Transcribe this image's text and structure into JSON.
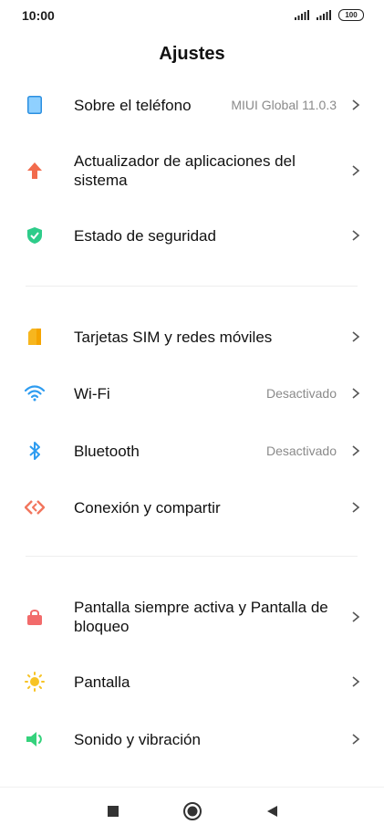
{
  "status_bar": {
    "time": "10:00",
    "battery": "100",
    "icons": [
      "signal-icon",
      "signal-icon",
      "battery-icon"
    ]
  },
  "header": {
    "title": "Ajustes"
  },
  "settings": [
    {
      "label": "Sobre el teléfono",
      "value": "MIUI Global 11.0.3",
      "icon": "phone-icon",
      "color": "#3b9ef0"
    },
    {
      "label": "Actualizador de aplicaciones del sistema",
      "value": "",
      "icon": "arrow-up-icon",
      "color": "#f26b4d"
    },
    {
      "label": "Estado de seguridad",
      "value": "",
      "icon": "shield-check-icon",
      "color": "#2ecc8a"
    },
    {
      "label": "Tarjetas SIM y redes móviles",
      "value": "",
      "icon": "sim-card-icon",
      "color": "#f7b61e"
    },
    {
      "label": "Wi-Fi",
      "value": "Desactivado",
      "icon": "wifi-icon",
      "color": "#2e9cf0"
    },
    {
      "label": "Bluetooth",
      "value": "Desactivado",
      "icon": "bluetooth-icon",
      "color": "#2e9cf0"
    },
    {
      "label": "Conexión y compartir",
      "value": "",
      "icon": "share-connection-icon",
      "color": "#f2765e"
    },
    {
      "label": "Pantalla siempre activa y Pantalla de bloqueo",
      "value": "",
      "icon": "lock-icon",
      "color": "#f26b6b"
    },
    {
      "label": "Pantalla",
      "value": "",
      "icon": "sun-icon",
      "color": "#f7c325"
    },
    {
      "label": "Sonido y vibración",
      "value": "",
      "icon": "speaker-icon",
      "color": "#35d27c"
    }
  ],
  "nav_bar": {
    "buttons": [
      "recents-icon",
      "home-icon",
      "back-icon"
    ]
  }
}
